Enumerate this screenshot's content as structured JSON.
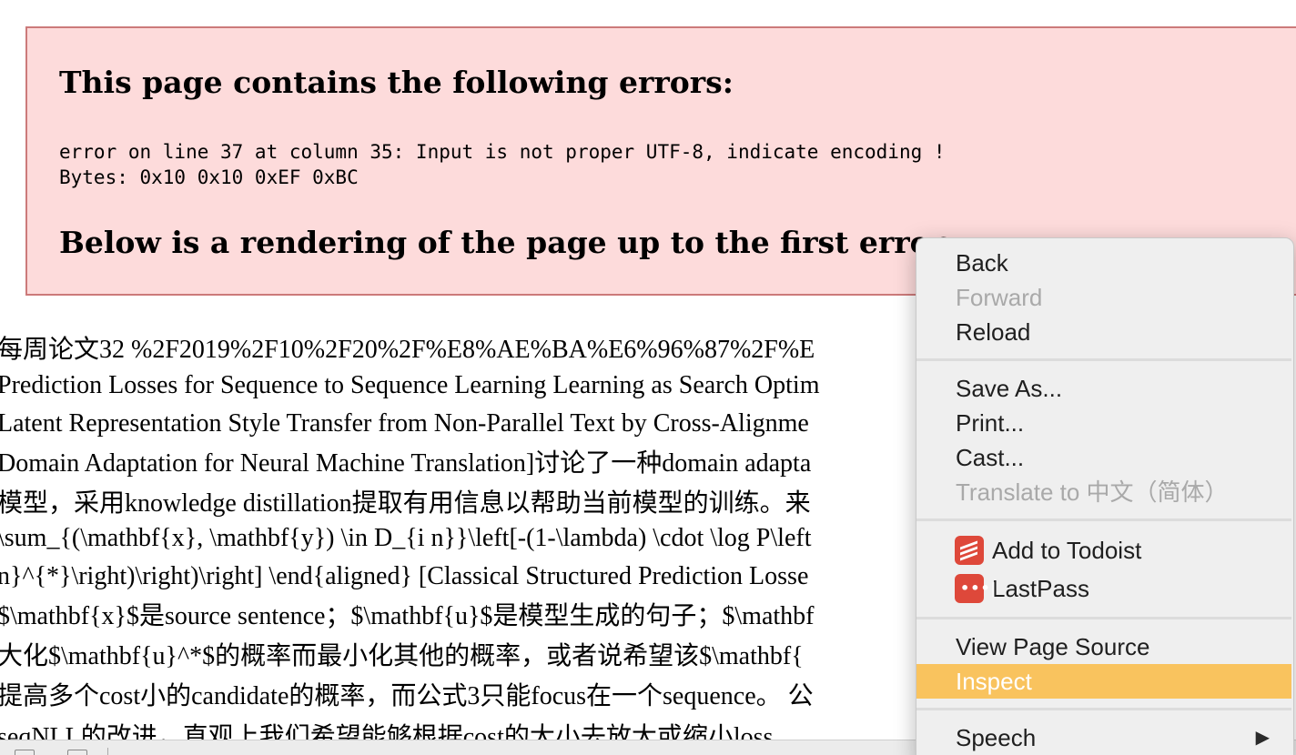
{
  "error_box": {
    "title": "This page contains the following errors:",
    "detail_line1": "error on line 37 at column 35: Input is not proper UTF-8, indicate encoding !",
    "detail_line2": "Bytes: 0x10 0x10 0xEF 0xBC",
    "below": "Below is a rendering of the page up to the first error."
  },
  "content_lines": [
    "每周论文32 %2F2019%2F10%2F20%2F%E8%AE%BA%E6%96%87%2F%E",
    "Prediction Losses for Sequence to Sequence Learning Learning as Search Optim",
    "Latent Representation Style Transfer from Non-Parallel Text by Cross-Alignme",
    "Domain Adaptation for Neural Machine Translation]讨论了一种domain adapta",
    "模型，采用knowledge distillation提取有用信息以帮助当前模型的训练。来",
    "\\sum_{(\\mathbf{x}, \\mathbf{y}) \\in D_{i n}}\\left[-(1-\\lambda) \\cdot \\log P\\left",
    "n}^{*}\\right)\\right)\\right] \\end{aligned} [Classical Structured Prediction Losse",
    "$\\mathbf{x}$是source sentence；$\\mathbf{u}$是模型生成的句子；$\\mathbf",
    "大化$\\mathbf{u}^*$的概率而最小化其他的概率，或者说希望该$\\mathbf{",
    "提高多个cost小的candidate的概率，而公式3只能focus在一个sequence。 公",
    "seqNLL的改进，直观上我们希望能够根据cost的大小去放大或缩小loss"
  ],
  "context_menu": {
    "back": "Back",
    "forward": "Forward",
    "reload": "Reload",
    "save_as": "Save As...",
    "print": "Print...",
    "cast": "Cast...",
    "translate": "Translate to 中文（简体）",
    "add_todoist": "Add to Todoist",
    "lastpass": "LastPass",
    "view_source": "View Page Source",
    "inspect": "Inspect",
    "speech": "Speech",
    "submenu_arrow": "▶"
  },
  "colors": {
    "error_bg": "#fddbdb",
    "error_border": "#cc7a7a",
    "menu_highlight": "#f9c35e",
    "todoist_icon": "#de483a",
    "lastpass_icon": "#de483a"
  }
}
